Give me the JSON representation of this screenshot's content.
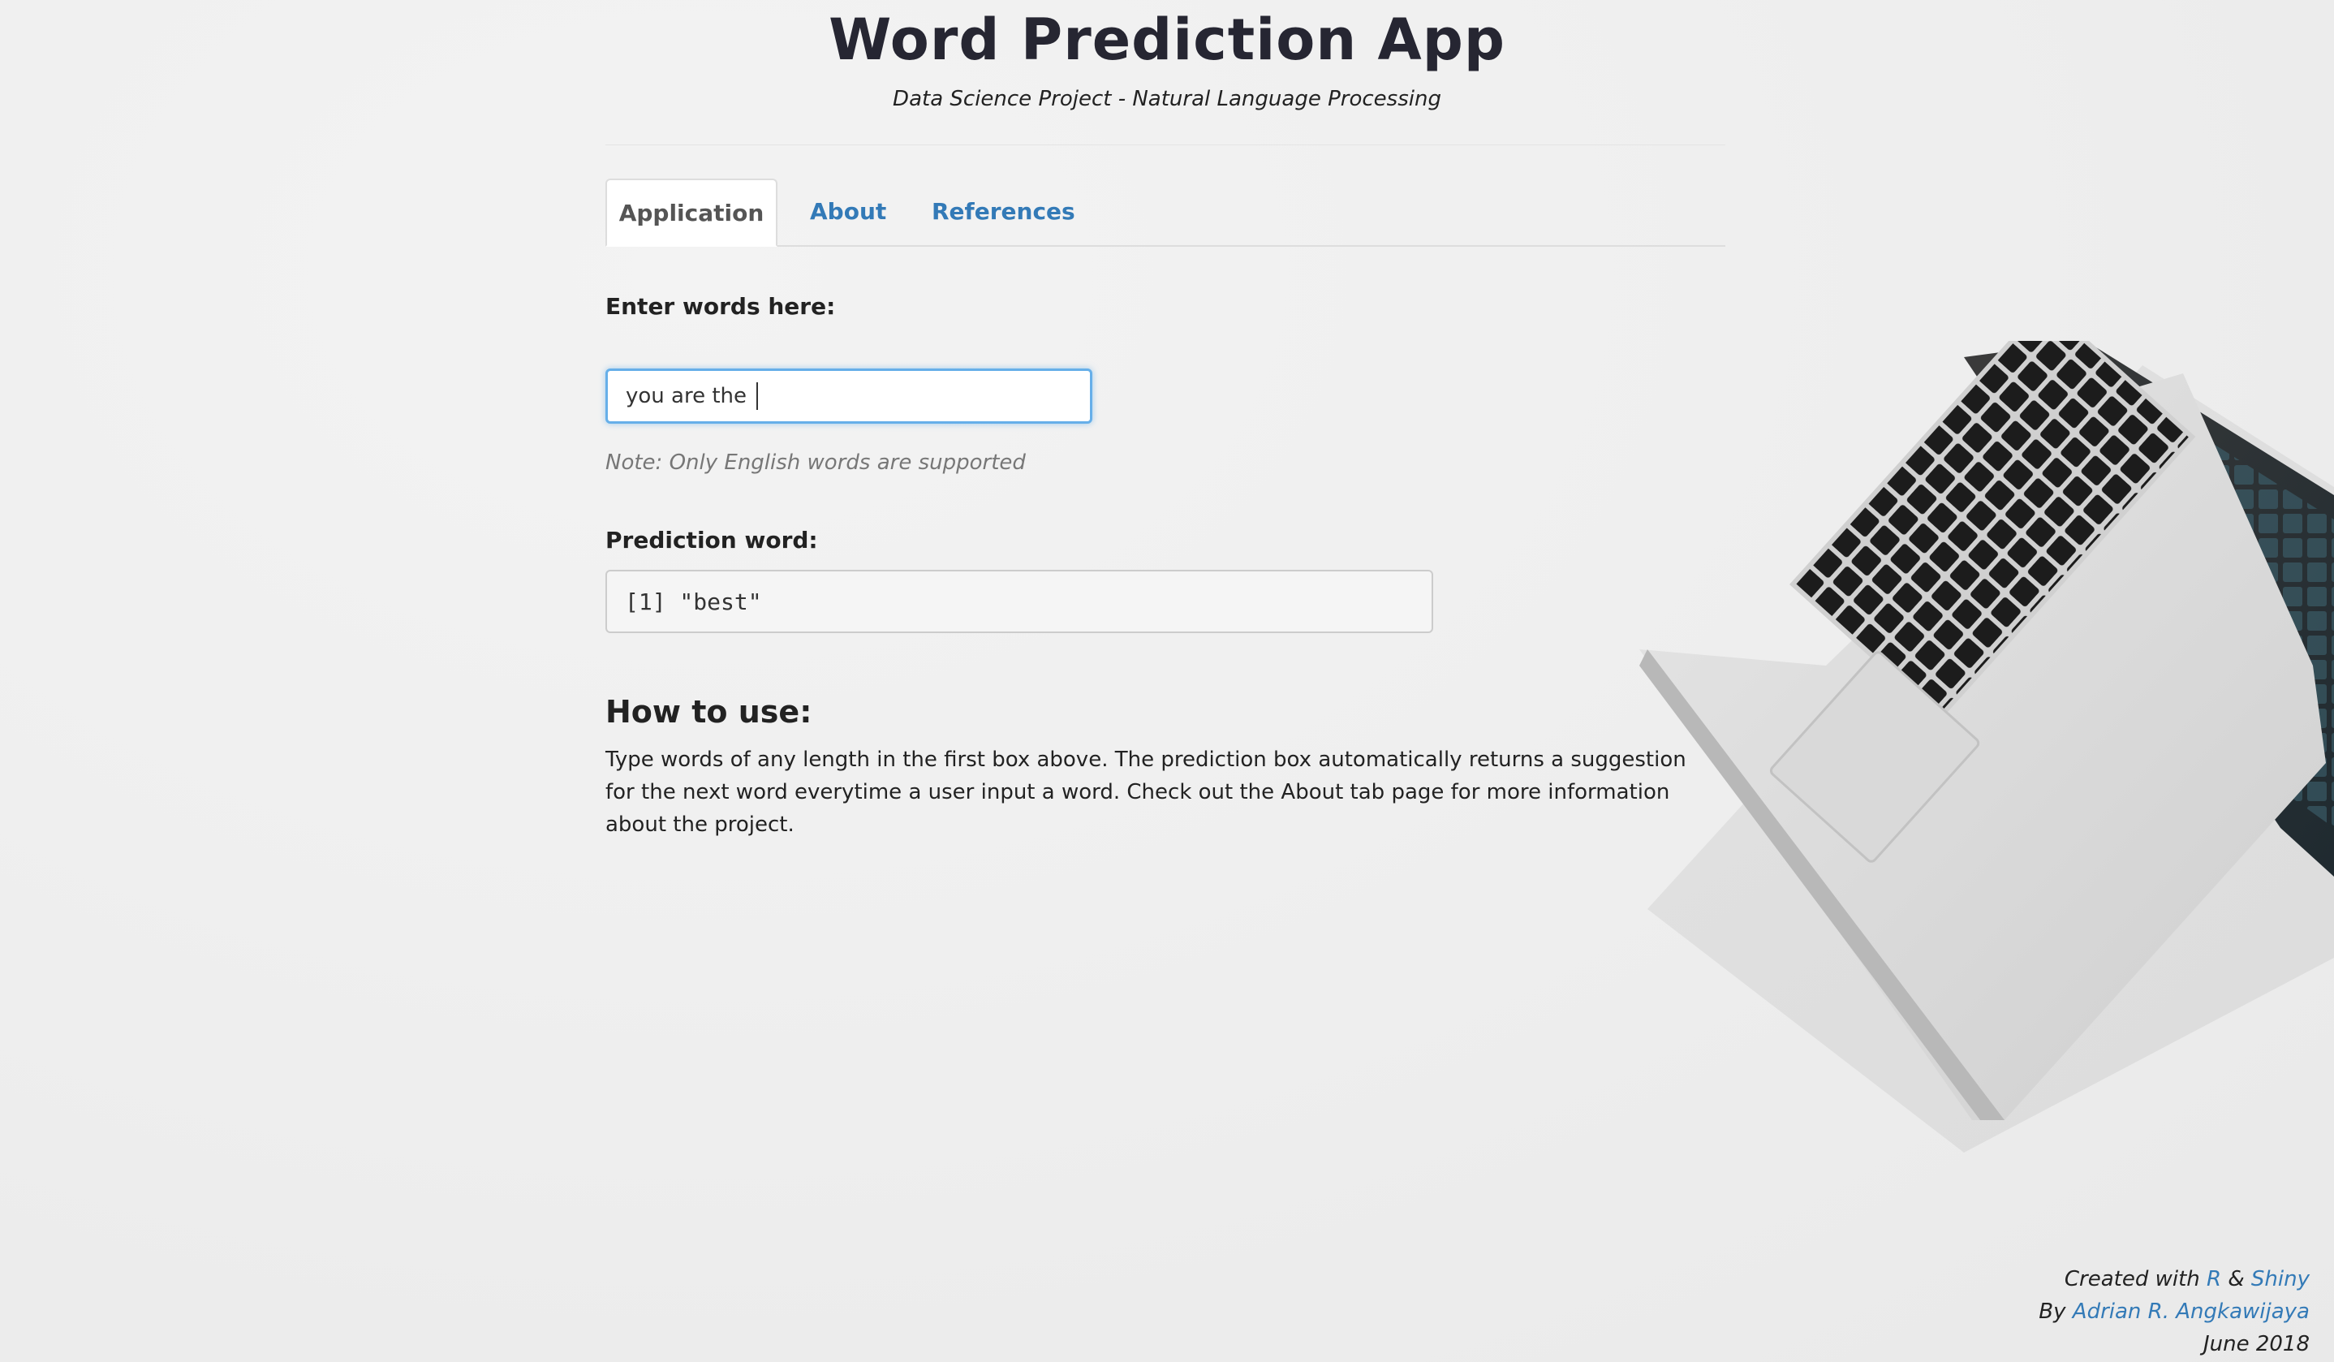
{
  "header": {
    "title": "Word Prediction App",
    "subtitle": "Data Science Project - Natural Language Processing"
  },
  "tabs": [
    {
      "label": "Application",
      "active": true
    },
    {
      "label": "About",
      "active": false
    },
    {
      "label": "References",
      "active": false
    }
  ],
  "input": {
    "label": "Enter words here:",
    "value": "you are the ",
    "note": "Note: Only English words are supported"
  },
  "prediction": {
    "label": "Prediction word:",
    "output": "[1] \"best\""
  },
  "how_to_use": {
    "heading": "How to use:",
    "text": "Type words of any length in the first box above. The prediction box automatically returns a suggestion for the next word everytime a user input a word. Check out the About tab page for more information about the project."
  },
  "footer": {
    "created_prefix": "Created with",
    "r_link": "R",
    "ampersand": "&",
    "shiny_link": "Shiny",
    "by_prefix": "By",
    "author_link": "Adrian R. Angkawijaya",
    "date": "June 2018"
  },
  "colors": {
    "link": "#337ab7",
    "focus_border": "#66afe9",
    "background": "#efefef"
  }
}
